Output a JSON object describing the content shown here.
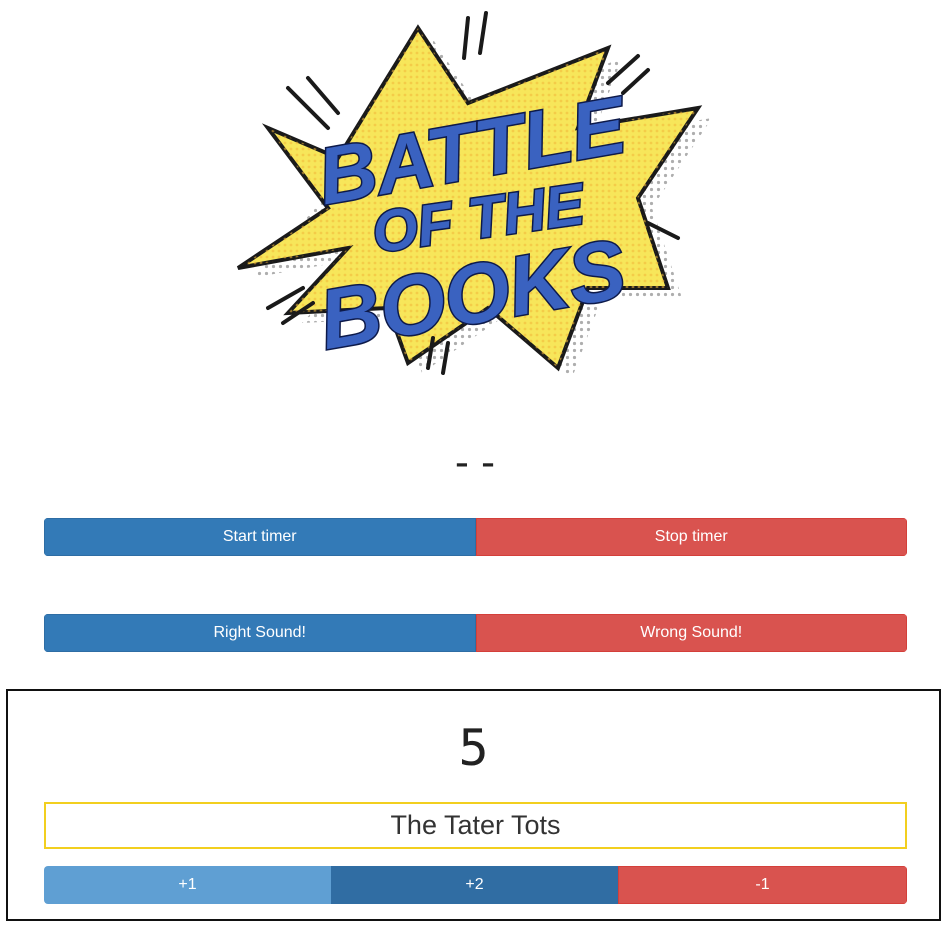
{
  "logo": {
    "line1": "BATTLE",
    "line2": "OF THE",
    "line3": "BOOKS"
  },
  "timer": {
    "display": "--",
    "start_label": "Start timer",
    "stop_label": "Stop timer"
  },
  "sounds": {
    "right_label": "Right Sound!",
    "wrong_label": "Wrong Sound!"
  },
  "team": {
    "score": "5",
    "name": "The Tater Tots",
    "plus_one_label": "+1",
    "plus_two_label": "+2",
    "minus_one_label": "-1"
  },
  "colors": {
    "primary": "#337ab7",
    "danger": "#d9534f",
    "team_border": "#f2cf1f",
    "logo_blue": "#3a62c0",
    "logo_yellow": "#f7e65a"
  }
}
